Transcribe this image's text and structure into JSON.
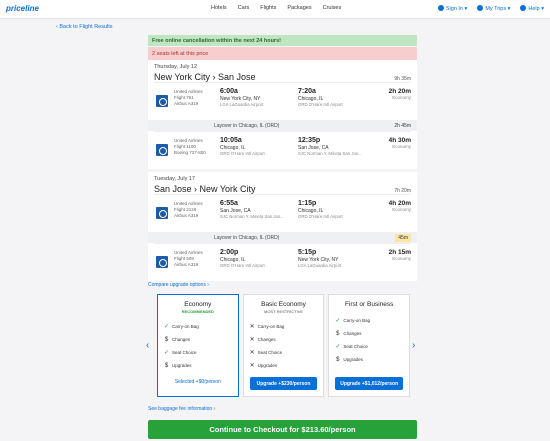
{
  "header": {
    "logo": "priceline",
    "nav": [
      "Hotels",
      "Cars",
      "Flights",
      "Packages",
      "Cruises"
    ],
    "sign_in": "Sign In ▾",
    "my_trips": "My Trips ▾",
    "help": "Help ▾"
  },
  "back_link": "‹ Back to Flight Results",
  "banners": {
    "green": "Free online cancellation within the next 24 hours!",
    "red": "2 seats left at this price"
  },
  "outbound": {
    "date": "Thursday, July 12",
    "route": "New York City › San Jose",
    "duration": "9h 35m",
    "segments": [
      {
        "airline": "United Airlines",
        "flight": "Flight 761",
        "aircraft": "Airbus A319",
        "dep_time": "6:00a",
        "dep_city": "New York City, NY",
        "dep_airport": "LGA LaGuardia Airport",
        "arr_time": "7:20a",
        "arr_city": "Chicago, IL",
        "arr_airport": "ORD O'Hare Intl Airport",
        "duration": "2h 20m",
        "cabin": "Economy"
      },
      {
        "airline": "United Airlines",
        "flight": "Flight 1100",
        "aircraft": "Boeing 737-800",
        "dep_time": "10:05a",
        "dep_city": "Chicago, IL",
        "dep_airport": "ORD O'Hare Intl Airport",
        "arr_time": "12:35p",
        "arr_city": "San Jose, CA",
        "arr_airport": "SJC Norman Y. Mineta San Jos...",
        "duration": "4h 30m",
        "cabin": "Economy"
      }
    ],
    "layover": {
      "text": "Layover in Chicago, IL (ORD)",
      "duration": "2h 45m"
    }
  },
  "return": {
    "date": "Tuesday, July 17",
    "route": "San Jose › New York City",
    "duration": "7h 20m",
    "segments": [
      {
        "airline": "United Airlines",
        "flight": "Flight 2126",
        "aircraft": "Airbus A319",
        "dep_time": "6:55a",
        "dep_city": "San Jose, CA",
        "dep_airport": "SJC Norman Y. Mineta San Jos...",
        "arr_time": "1:15p",
        "arr_city": "Chicago, IL",
        "arr_airport": "ORD O'Hare Intl Airport",
        "duration": "4h 20m",
        "cabin": "Economy"
      },
      {
        "airline": "United Airlines",
        "flight": "Flight 509",
        "aircraft": "Airbus A319",
        "dep_time": "2:00p",
        "dep_city": "Chicago, IL",
        "dep_airport": "ORD O'Hare Intl Airport",
        "arr_time": "5:15p",
        "arr_city": "New York City, NY",
        "arr_airport": "LGA LaGuardia Airport",
        "duration": "2h 15m",
        "cabin": "Economy"
      }
    ],
    "layover": {
      "text": "Layover in Chicago, IL (ORD)",
      "duration": "45m"
    }
  },
  "upgrade_link": "Compare upgrade options ›",
  "options": [
    {
      "title": "Economy",
      "subtitle": "RECOMMENDED",
      "features": [
        [
          "✓",
          "Carry-on Bag"
        ],
        [
          "$",
          "Changes"
        ],
        [
          "✓",
          "Seat Choice"
        ],
        [
          "$",
          "Upgrades"
        ]
      ],
      "action": "Selected +$0/person"
    },
    {
      "title": "Basic Economy",
      "subtitle": "MOST RESTRICTIVE",
      "features": [
        [
          "✕",
          "Carry-on Bag"
        ],
        [
          "✕",
          "Changes"
        ],
        [
          "✕",
          "Seat Choice"
        ],
        [
          "✕",
          "Upgrades"
        ]
      ],
      "action": "Upgrade +$230/person"
    },
    {
      "title": "First or Business",
      "subtitle": "",
      "features": [
        [
          "✓",
          "Carry-on Bag"
        ],
        [
          "$",
          "Changes"
        ],
        [
          "✓",
          "Seat Choice"
        ],
        [
          "$",
          "Upgrades"
        ]
      ],
      "action": "Upgrade +$1,012/person"
    }
  ],
  "baggage_link": "See baggage fee information ›",
  "checkout": "Continue to Checkout for $213.60/person",
  "colors": {
    "brand": "#0a6fd6",
    "checkout": "#27a13a"
  }
}
